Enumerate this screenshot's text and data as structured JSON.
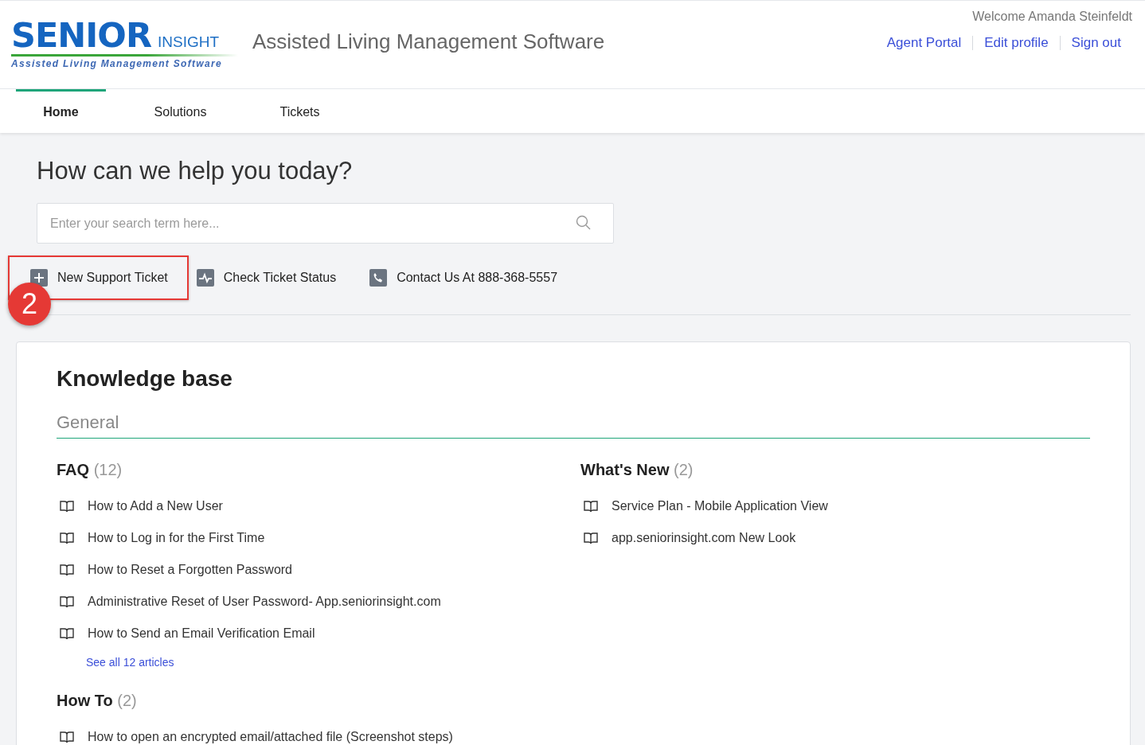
{
  "logo": {
    "name": "SENIOR",
    "suffix": "INSIGHT",
    "tagline": "Assisted Living Management Software"
  },
  "site_title": "Assisted Living Management Software",
  "user": {
    "welcome": "Welcome Amanda Steinfeldt",
    "links": [
      "Agent Portal",
      "Edit profile",
      "Sign out"
    ]
  },
  "tabs": [
    {
      "label": "Home",
      "selected": true
    },
    {
      "label": "Solutions",
      "selected": false
    },
    {
      "label": "Tickets",
      "selected": false
    }
  ],
  "heading": "How can we help you today?",
  "search": {
    "placeholder": "Enter your search term here..."
  },
  "actions": [
    {
      "kind": "new",
      "label": "New Support Ticket",
      "highlighted": true
    },
    {
      "kind": "status",
      "label": "Check Ticket Status",
      "highlighted": false
    },
    {
      "kind": "phone",
      "label": "Contact Us At 888-368-5557",
      "highlighted": false
    }
  ],
  "step_marker": "2",
  "knowledge_base": {
    "title": "Knowledge base",
    "section": "General",
    "categories": [
      {
        "name": "FAQ",
        "count": "(12)",
        "articles": [
          "How to Add a New User",
          "How to Log in for the First Time",
          "How to Reset a Forgotten Password",
          "Administrative Reset of User Password- App.seniorinsight.com",
          "How to Send an Email Verification Email"
        ],
        "see_all": "See all 12 articles"
      },
      {
        "name": "What's New",
        "count": "(2)",
        "articles": [
          "Service Plan - Mobile Application View",
          "app.seniorinsight.com New Look"
        ]
      },
      {
        "name": "How To",
        "count": "(2)",
        "articles": [
          "How to open an encrypted email/attached file (Screenshot steps)"
        ]
      }
    ]
  }
}
